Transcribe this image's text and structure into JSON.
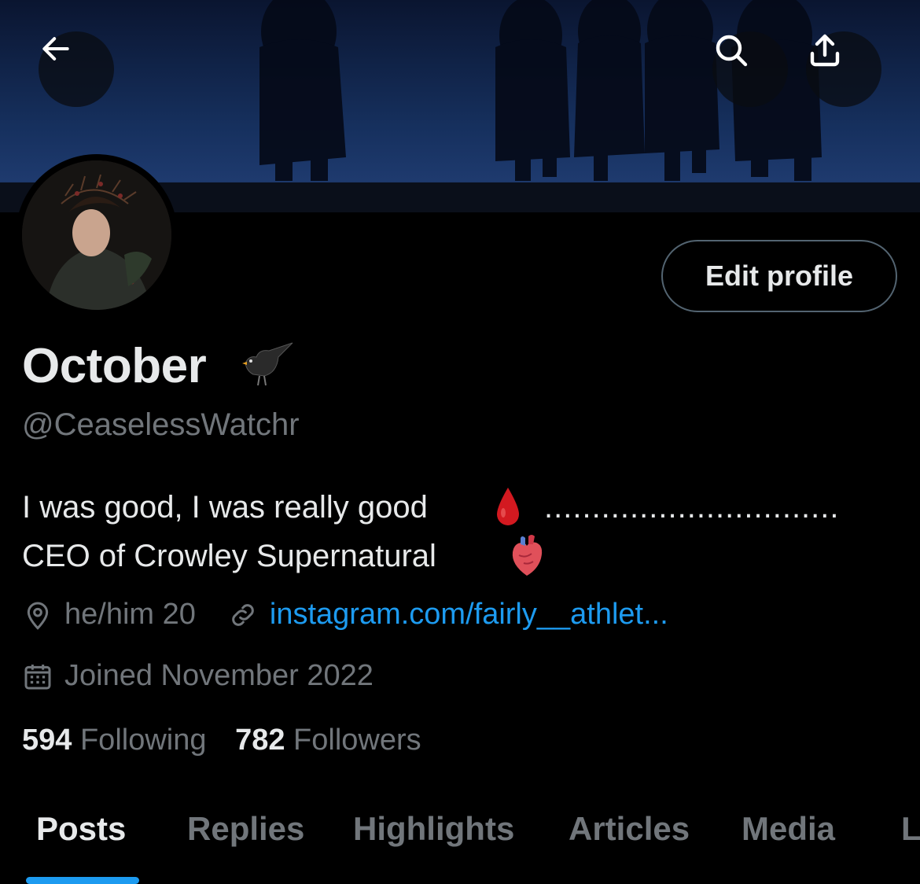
{
  "profile": {
    "display_name": "October",
    "handle": "@CeaselessWatchr",
    "bio_line1": "I was good, I was really good",
    "bio_dots": "...............................",
    "bio_line2": "CEO of Crowley Supernatural",
    "location": "he/him 20",
    "website": "instagram.com/fairly__athlet...",
    "joined": "Joined November 2022"
  },
  "actions": {
    "edit_profile": "Edit profile"
  },
  "stats": {
    "following_count": "594",
    "following_label": "Following",
    "followers_count": "782",
    "followers_label": "Followers"
  },
  "tabs": [
    {
      "label": "Posts",
      "active": true
    },
    {
      "label": "Replies"
    },
    {
      "label": "Highlights"
    },
    {
      "label": "Articles"
    },
    {
      "label": "Media"
    },
    {
      "label": "L"
    }
  ],
  "icons": {
    "back": "arrow-left-icon",
    "search": "search-icon",
    "share": "share-icon",
    "location": "location-pin-icon",
    "link": "link-icon",
    "calendar": "calendar-icon",
    "bird": "blackbird-emoji",
    "blood": "drop-of-blood-emoji",
    "heart": "anatomical-heart-emoji"
  },
  "colors": {
    "accent": "#1d9bf0",
    "muted": "#71767b",
    "text": "#e7e9ea",
    "background": "#000000"
  }
}
